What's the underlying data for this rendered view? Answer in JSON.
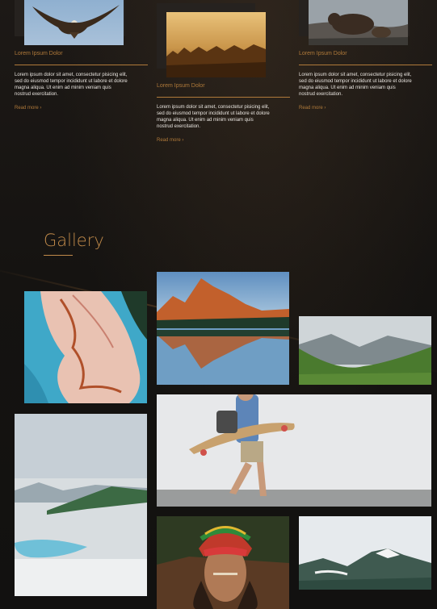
{
  "cards": [
    {
      "title": "Lorem Ipsum Dolor",
      "body": "Lorem ipsum dolor sit amet, consectetur pisicing elit, sed do eiusmod tempor incididunt ut labore et dolore magna aliqua. Ut enim ad minim veniam quis nostrud exercitation.",
      "link": "Read more ›",
      "image_icon": "eagle-image"
    },
    {
      "title": "Lorem Ipsum Dolor",
      "body": "Lorem ipsum dolor sit amet, consectetur pisicing elit, sed do eiusmod tempor incididunt ut labore et dolore magna aliqua. Ut enim ad minim veniam quis nostrud exercitation.",
      "link": "Read more ›",
      "image_icon": "forest-sunset-image"
    },
    {
      "title": "Lorem Ipsum Dolor",
      "body": "Lorem ipsum dolor sit amet, consectetur pisicing elit, sed do eiusmod tempor incididunt ut labore et dolore magna aliqua. Ut enim ad minim veniam quis nostrud exercitation.",
      "link": "Read more ›",
      "image_icon": "bear-image"
    }
  ],
  "gallery": {
    "title": "Gallery",
    "photos": [
      "aerial-river-photo",
      "mountain-lake-photo",
      "green-valley-photo",
      "snowy-landscape-photo",
      "skateboarder-photo",
      "tribal-portrait-photo",
      "cloudy-mountain-photo"
    ]
  },
  "colors": {
    "accent": "#b07a3a",
    "background": "#161412",
    "text": "#e8e4df"
  }
}
